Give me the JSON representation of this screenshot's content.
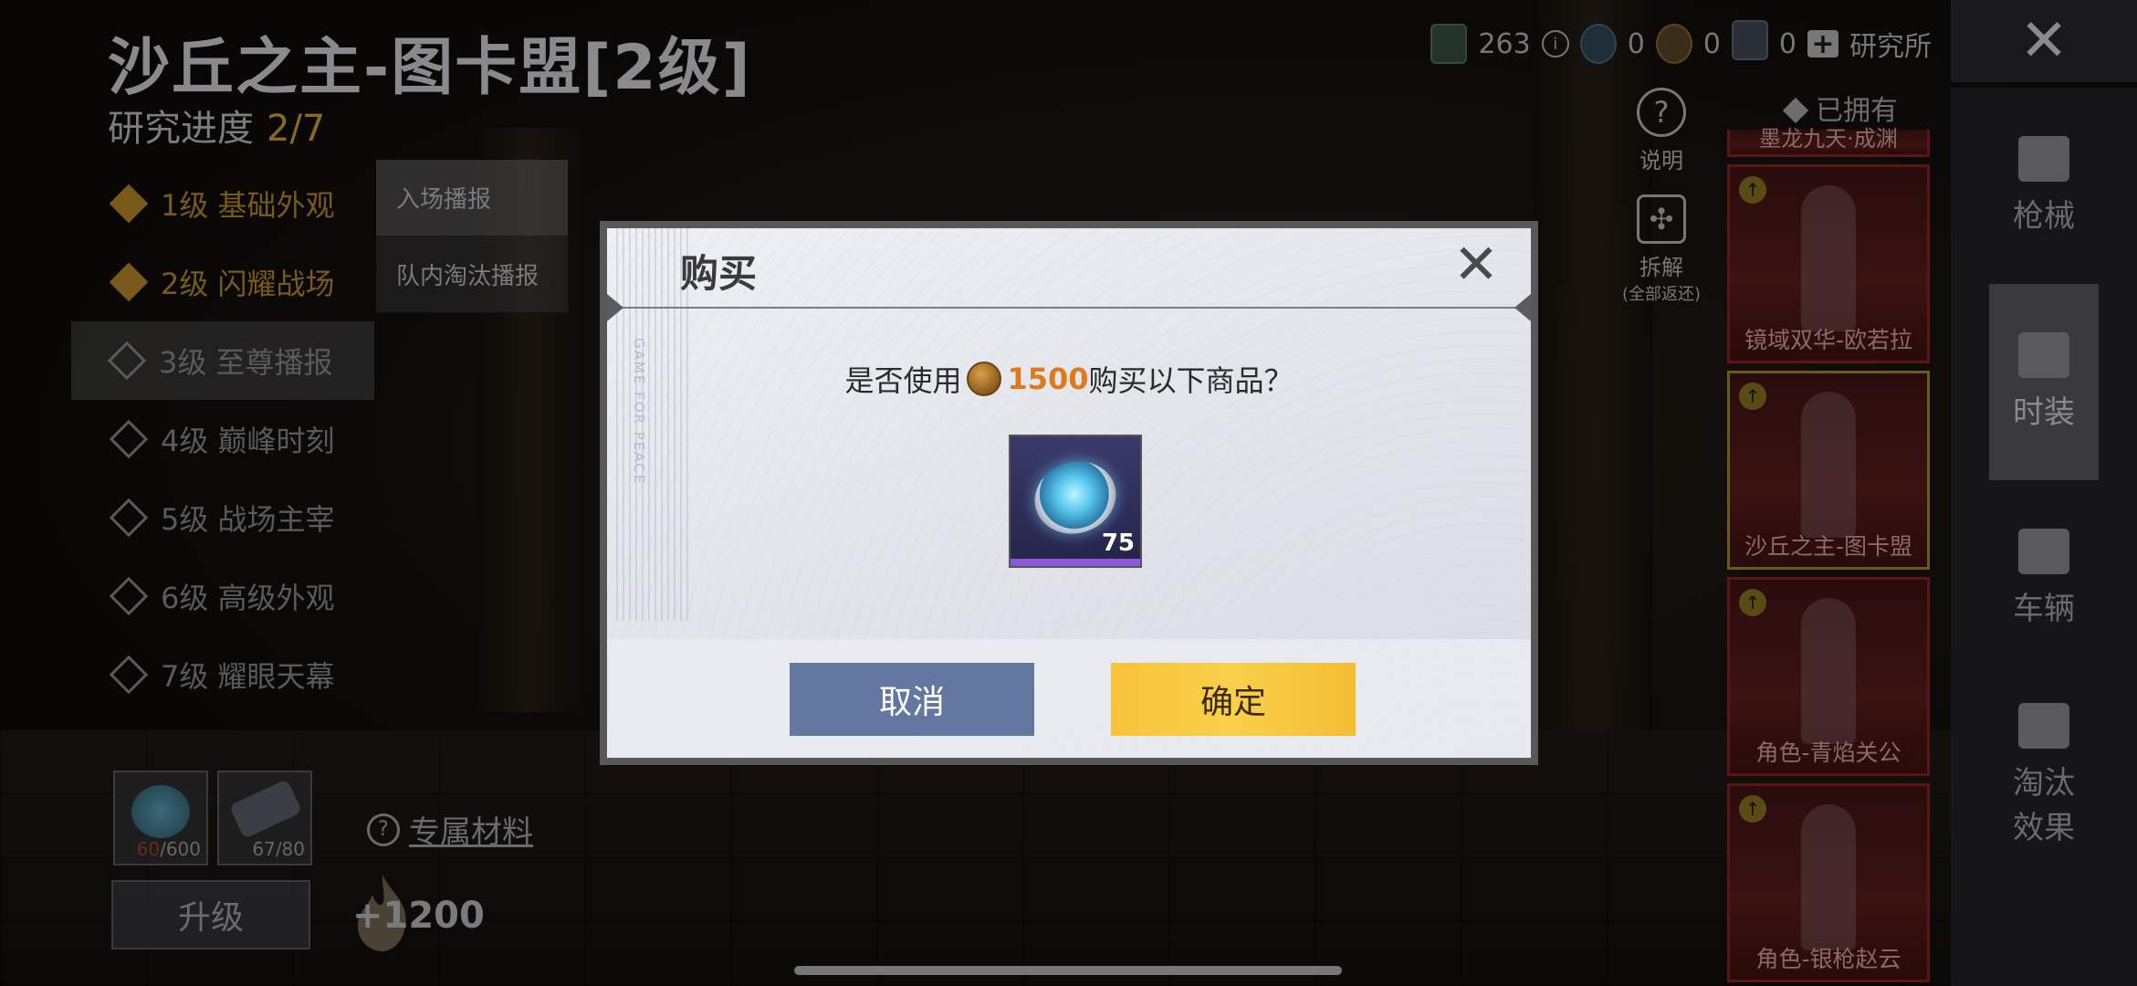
{
  "header": {
    "title": "沙丘之主-图卡盟[2级]",
    "progress_label": "研究进度",
    "progress_value": "2/7"
  },
  "levels": [
    {
      "label": "1级 基础外观",
      "state": "done"
    },
    {
      "label": "2级 闪耀战场",
      "state": "done"
    },
    {
      "label": "3级 至尊播报",
      "state": "active"
    },
    {
      "label": "4级 巅峰时刻",
      "state": "locked"
    },
    {
      "label": "5级 战场主宰",
      "state": "locked"
    },
    {
      "label": "6级 高级外观",
      "state": "locked"
    },
    {
      "label": "7级 耀眼天幕",
      "state": "locked"
    }
  ],
  "subtabs": [
    "入场播报",
    "队内淘汰播报"
  ],
  "materials": [
    {
      "count_have": "60",
      "count_need": "/600",
      "icon": "blue-disc-icon"
    },
    {
      "count_have": "67",
      "count_need": "/80",
      "icon": "gear-part-icon"
    }
  ],
  "exclusive_material_label": "专属材料",
  "upgrade_label": "升级",
  "bonus": "+1200",
  "topbar": {
    "ticket_count": "263",
    "info_icon": "info-icon",
    "blue_count": "0",
    "coin_count": "0",
    "card_count": "0",
    "institute_label": "研究所"
  },
  "tools": [
    {
      "label": "说明",
      "icon": "question-icon"
    },
    {
      "label": "拆解",
      "sub": "(全部返还)",
      "icon": "puzzle-icon"
    }
  ],
  "owned_label": "已拥有",
  "cards": [
    {
      "name": "墨龙九天·成渊",
      "partial": true
    },
    {
      "name": "镜域双华-欧若拉"
    },
    {
      "name": "沙丘之主-图卡盟",
      "selected": true
    },
    {
      "name": "角色-青焰关公"
    },
    {
      "name": "角色-银枪赵云"
    }
  ],
  "categories": [
    {
      "label": "枪械",
      "icon": "gun-icon"
    },
    {
      "label": "时装",
      "icon": "outfit-icon",
      "active": true
    },
    {
      "label": "车辆",
      "icon": "vehicle-icon"
    },
    {
      "label": "淘汰效果",
      "icon": "elimination-icon"
    }
  ],
  "dialog": {
    "title": "购买",
    "side_text": "GAME FOR PEACE",
    "question_prefix": "是否使用",
    "price": "1500",
    "question_suffix": "购买以下商品？",
    "item_quantity": "75",
    "cancel_label": "取消",
    "confirm_label": "确定"
  },
  "colors": {
    "price": "#e0781c",
    "confirm": "#f7c43a",
    "cancel": "#6378a0"
  }
}
